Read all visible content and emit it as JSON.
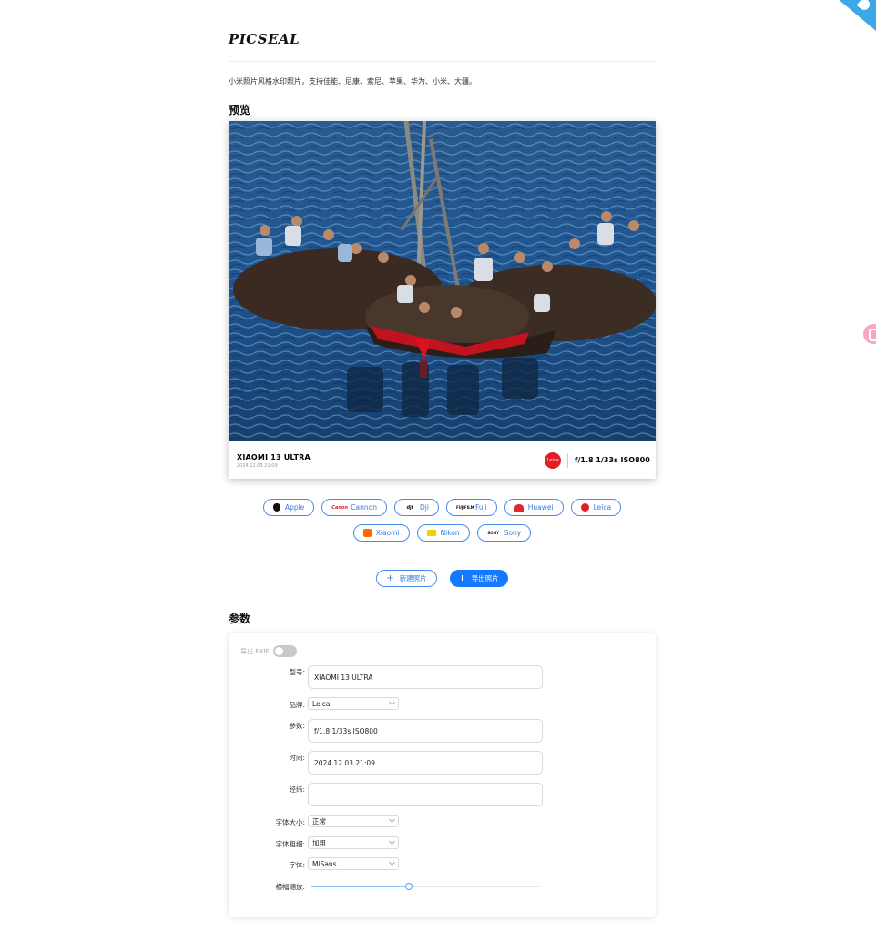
{
  "app": {
    "logo": "PICSEAL",
    "description": "小米照片风格水印照片，支持佳能、尼康、索尼、苹果、华为、小米、大疆。"
  },
  "sections": {
    "preview": "预览",
    "params": "参数"
  },
  "watermark": {
    "model": "XIAOMI 13 ULTRA",
    "date": "2024.12.03 21:09",
    "logo_text": "Leica",
    "params": "f/1.8 1/33s ISO800"
  },
  "brands": {
    "row1": [
      {
        "label": "Apple",
        "icon": "apple-icon",
        "icon_text": ""
      },
      {
        "label": "Cannon",
        "icon": "canon-icon",
        "icon_text": "Canon"
      },
      {
        "label": "Dji",
        "icon": "dji-icon",
        "icon_text": "dji"
      },
      {
        "label": "Fuji",
        "icon": "fuji-icon",
        "icon_text": "FUJIFILM"
      },
      {
        "label": "Huawei",
        "icon": "huawei-icon",
        "icon_text": ""
      },
      {
        "label": "Leica",
        "icon": "leica-icon",
        "icon_text": ""
      }
    ],
    "row2": [
      {
        "label": "Xiaomi",
        "icon": "xiaomi-icon",
        "icon_text": ""
      },
      {
        "label": "Nikon",
        "icon": "nikon-icon",
        "icon_text": ""
      },
      {
        "label": "Sony",
        "icon": "sony-icon",
        "icon_text": "SONY"
      }
    ]
  },
  "actions": {
    "new_label": "新建照片",
    "export_label": "导出照片"
  },
  "form": {
    "exif_label": "导出 EXIF",
    "exif_enabled": false,
    "model_label": "型号:",
    "model_value": "XIAOMI 13 ULTRA",
    "brand_label": "品牌:",
    "brand_value": "Leica",
    "params_label": "参数:",
    "params_value": "f/1.8 1/33s ISO800",
    "time_label": "时间:",
    "time_value": "2024.12.03 21:09",
    "coords_label": "经纬:",
    "coords_value": "",
    "font_size_label": "字体大小:",
    "font_size_value": "正常",
    "font_weight_label": "字体粗细:",
    "font_weight_value": "加粗",
    "font_label": "字体:",
    "font_value": "MiSans",
    "scale_label": "横幅缩放:",
    "scale_fraction": 0.43
  },
  "colors": {
    "accent": "#1677ff",
    "leica_red": "#e21e25"
  }
}
